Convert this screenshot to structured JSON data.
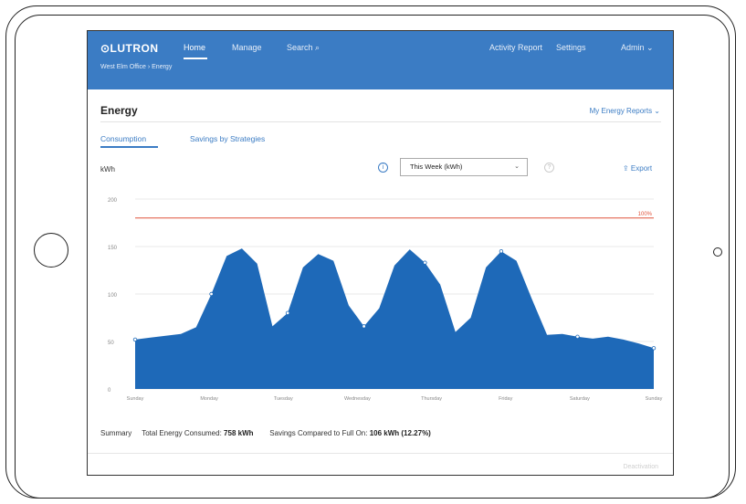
{
  "app": {
    "logo": "⊙LUTRON",
    "nav": {
      "home": "Home",
      "manage": "Manage",
      "search": "Search ⌕"
    },
    "right_nav": {
      "activity": "Activity Report",
      "settings": "Settings",
      "admin": "Admin ⌄"
    },
    "breadcrumb": "West Elm Office  ›  Energy"
  },
  "page": {
    "title": "Energy",
    "reports_menu": "My Energy Reports ⌄",
    "tabs": {
      "consumption": "Consumption",
      "savings": "Savings by Strategies"
    },
    "unit_label": "kWh",
    "info_glyph": "i",
    "help_glyph": "?",
    "period": "This Week (kWh)",
    "period_chevron": "⌄",
    "export": "⇪ Export"
  },
  "summary": {
    "label": "Summary",
    "total_label": "Total Energy Consumed:",
    "total_value": "758 kWh",
    "savings_label": "Savings Compared to Full On:",
    "savings_value": "106 kWh (12.27%)"
  },
  "footer": {
    "text": "Deactivation"
  },
  "colors": {
    "accent": "#3b7cc4",
    "area": "#1e69b8",
    "reference": "#e0533b"
  },
  "chart_data": {
    "type": "area",
    "x": [
      "Sunday",
      "Monday",
      "Tuesday",
      "Wednesday",
      "Thursday",
      "Friday",
      "Saturday",
      "Sunday"
    ],
    "ylim": [
      0,
      200
    ],
    "yticks": [
      "0",
      "50",
      "100",
      "150",
      "200"
    ],
    "reference_label": "100%",
    "reference_value": 180,
    "grid": true,
    "series": [
      {
        "values": [
          52,
          54,
          56,
          58,
          65,
          100,
          140,
          148,
          132,
          66,
          80,
          128,
          142,
          135,
          88,
          66,
          85,
          130,
          147,
          133,
          110,
          60,
          75,
          128,
          145,
          135,
          95,
          57,
          58,
          55,
          53,
          55,
          52,
          48,
          43
        ]
      }
    ]
  }
}
